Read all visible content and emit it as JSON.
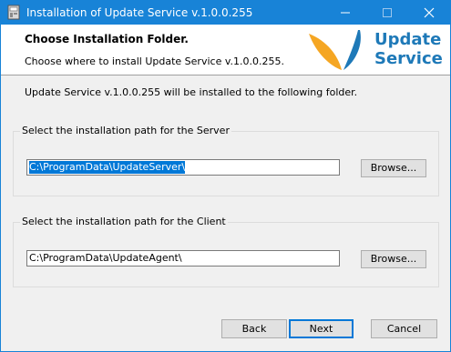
{
  "window": {
    "title": "Installation of Update Service v.1.0.0.255"
  },
  "header": {
    "title": "Choose Installation Folder.",
    "subtitle": "Choose where to install Update Service v.1.0.0.255.",
    "logo_line1": "Update",
    "logo_line2": "Service",
    "logo_colors": {
      "orange": "#f5a623",
      "blue": "#1e79b8"
    }
  },
  "intro": "Update Service v.1.0.0.255 will be installed to the following folder.",
  "server": {
    "label": "Select the installation path for the Server",
    "path": "C:\\ProgramData\\UpdateServer\\",
    "browse_label": "Browse..."
  },
  "client": {
    "label": "Select the installation path for the Client",
    "path": "C:\\ProgramData\\UpdateAgent\\",
    "browse_label": "Browse..."
  },
  "footer": {
    "back_label": "Back",
    "next_label": "Next",
    "cancel_label": "Cancel"
  },
  "colors": {
    "titlebar": "#1883d7",
    "selection": "#0078d7",
    "default_button_border": "#0078d7"
  },
  "icons": {
    "app": "installer-icon",
    "minimize": "minimize-icon",
    "maximize": "maximize-icon",
    "close": "close-icon"
  }
}
